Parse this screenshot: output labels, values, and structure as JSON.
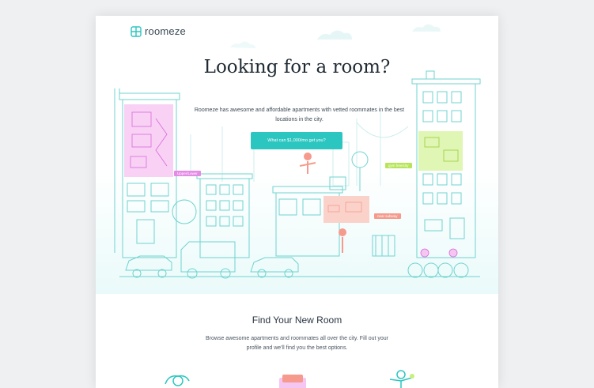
{
  "brand": {
    "name": "roomeze"
  },
  "hero": {
    "title": "Looking for a room?",
    "description": "Roomeze has awesome and affordable apartments with vetted roommates in the best locations in the city.",
    "cta_label": "What can $1,000/mo get you?",
    "tags": {
      "left": "Upper/Lower",
      "right_top": "gym free/city",
      "center": "near subway"
    }
  },
  "section": {
    "title": "Find Your New Room",
    "description": "Browse awesome apartments and roommates all over the city. Fill out your profile and we'll find you the best options."
  },
  "colors": {
    "accent": "#2cc6c0",
    "pink": "#e58be6",
    "lime": "#c9f07a",
    "salmon": "#f59a8c",
    "line": "#6fd3cf"
  }
}
